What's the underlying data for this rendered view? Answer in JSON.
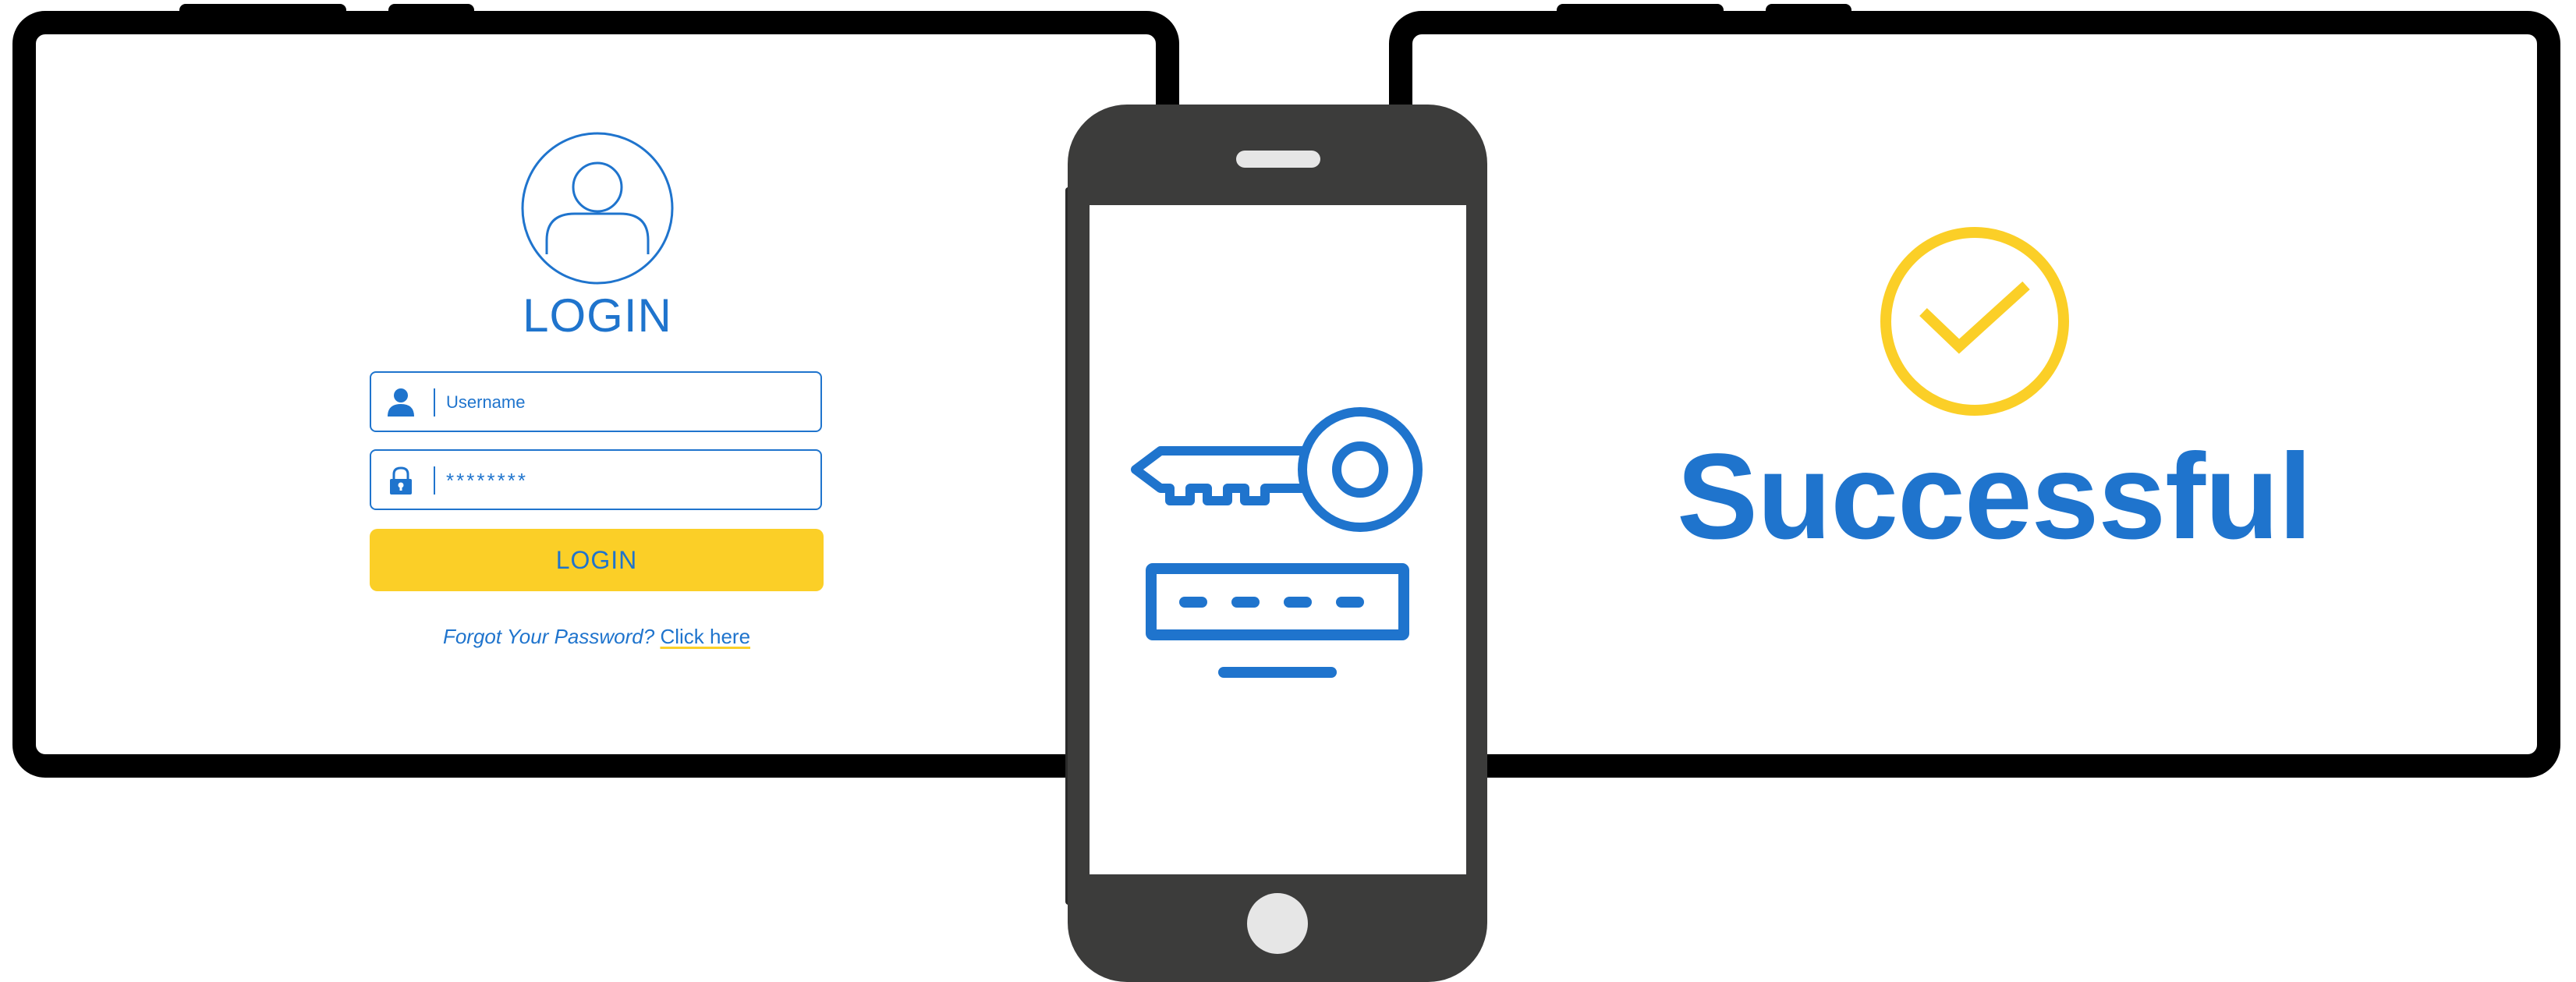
{
  "login": {
    "title": "LOGIN",
    "username_placeholder": "Username",
    "password_value": "********",
    "button_label": "LOGIN",
    "forgot_text": "Forgot Your Password?",
    "click_here": "Click here"
  },
  "success": {
    "text": "Successful"
  },
  "icons": {
    "avatar": "user-avatar-icon",
    "username": "user-icon",
    "password": "padlock-icon",
    "key": "key-icon",
    "password_entry": "password-entry-icon",
    "success": "check-circle-icon"
  },
  "colors": {
    "accent_blue": "#1f74cd",
    "accent_yellow": "#fbcf27",
    "phone_body": "#3c3c3b",
    "frame": "#000000"
  }
}
